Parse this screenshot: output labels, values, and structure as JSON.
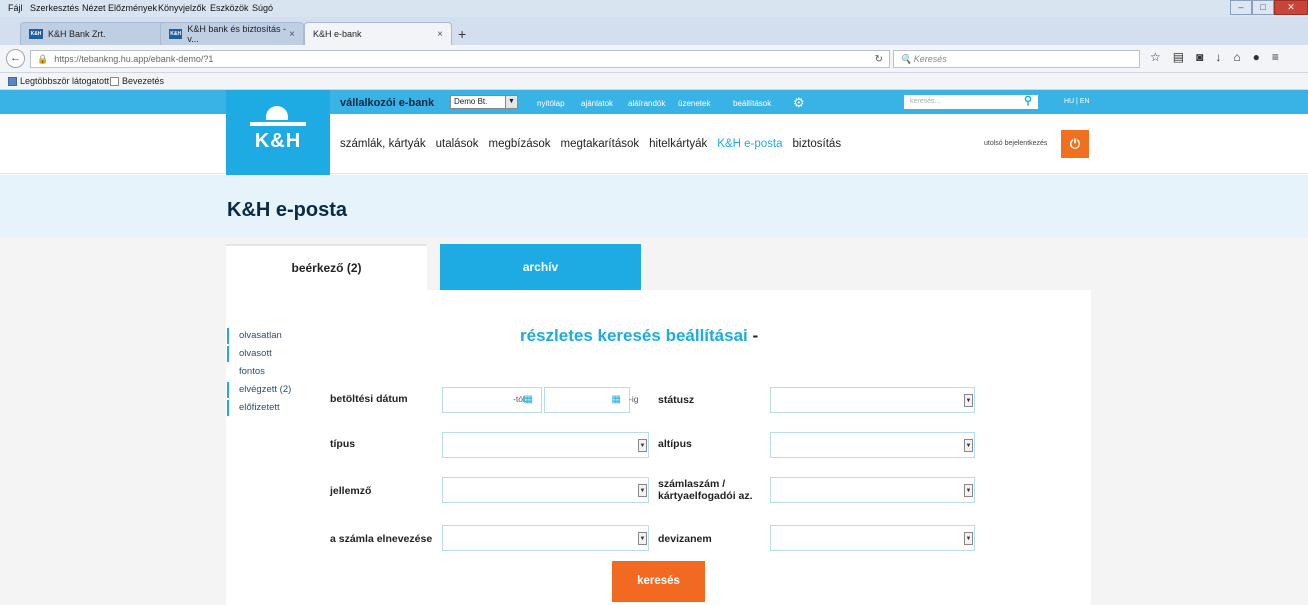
{
  "browser": {
    "menu": [
      "Fájl",
      "Szerkesztés",
      "Nézet",
      "Előzmények",
      "Könyvjelzők",
      "Eszközök",
      "Súgó"
    ],
    "tabs": [
      {
        "label": "K&H Bank Zrt."
      },
      {
        "label": "K&H bank és biztosítás - v..."
      },
      {
        "label": "K&H e-bank"
      }
    ],
    "url": "https://tebankng.hu.app/ebank-demo/?1",
    "search_placeholder": "Keresés",
    "bookmarks": [
      "Legtöbbször látogatott",
      "Bevezetés"
    ]
  },
  "site": {
    "logo_text": "K&H",
    "service_title": "vállalkozói e-bank",
    "company": "Demo Bt.",
    "top_links": [
      "nyitólap",
      "ajánlatok",
      "aláírandók",
      "üzenetek",
      "beállítások"
    ],
    "search_placeholder": "keresés...",
    "lang": "HU | EN",
    "main_nav": [
      "számlák, kártyák",
      "utalások",
      "megbízások",
      "megtakarítások",
      "hitelkártyák",
      "K&H e-posta",
      "biztosítás"
    ],
    "last_login": "utolsó bejelentkezés"
  },
  "page": {
    "title": "K&H e-posta",
    "tab_inbox": "beérkező (2)",
    "tab_archive": "archív",
    "filters": [
      "olvasatlan",
      "olvasott",
      "fontos",
      "elvégzett (2)",
      "előfizetett"
    ],
    "search_title": "részletes keresés beállításai",
    "search_title_suffix": "-",
    "form": {
      "load_date": "betöltési dátum",
      "from_suffix": "-tól",
      "to_suffix": "-ig",
      "status": "státusz",
      "type": "típus",
      "subtype": "altípus",
      "feature": "jellemző",
      "account_number": "számlaszám / kártyaelfogadói az.",
      "account_name": "a számla elnevezése",
      "currency": "devizanem"
    },
    "search_button": "keresés"
  },
  "colors": {
    "accent": "#1eabe3",
    "orange": "#f26a21",
    "navy": "#0b2a44"
  }
}
